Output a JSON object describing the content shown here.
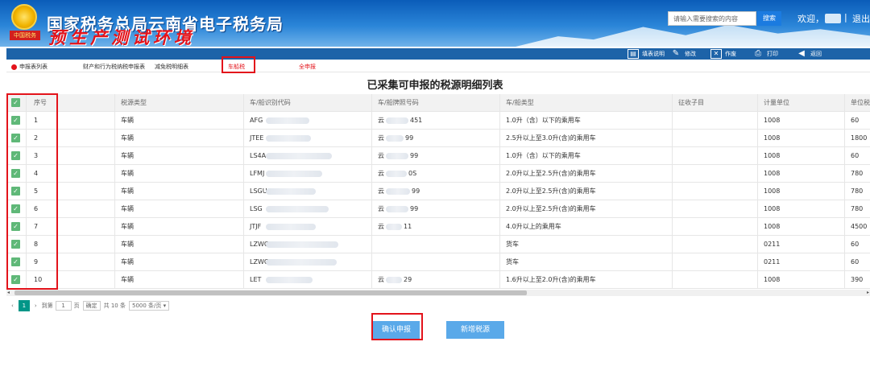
{
  "header": {
    "title": "国家税务总局云南省电子税务局",
    "subtitle": "预生产测试环境",
    "emblem_text": "中国税务",
    "search": {
      "placeholder": "请输入需要搜索的内容",
      "button": "搜索"
    },
    "welcome": "欢迎，",
    "separator": "|",
    "logout": "退出"
  },
  "toolbar": [
    {
      "label": "填表说明",
      "icon": "doc-icon"
    },
    {
      "label": "修改",
      "icon": "pencil-icon"
    },
    {
      "label": "作废",
      "icon": "void-icon"
    },
    {
      "label": "打印",
      "icon": "printer-icon"
    },
    {
      "label": "返回",
      "icon": "back-arrow-icon"
    }
  ],
  "tabs": [
    {
      "label": "申报表列表"
    },
    {
      "label": "财产和行为税纳税申报表"
    },
    {
      "label": "减免税明细表"
    },
    {
      "label": "车船税"
    },
    {
      "label": "全申报"
    }
  ],
  "page_title": "已采集可申报的税源明细列表",
  "table": {
    "columns": [
      "序号",
      "税源类型",
      "车/船识别代码",
      "车/船牌照号码",
      "车/船类型",
      "征收子目",
      "计量单位",
      "单位税"
    ],
    "rows": [
      {
        "no": "1",
        "type": "车辆",
        "code": "AFG",
        "plate_prefix": "云",
        "plate_suffix": "451",
        "vtype": "1.0升（含）以下的乘用车",
        "sub": "",
        "unit": "1008",
        "tax": "60"
      },
      {
        "no": "2",
        "type": "车辆",
        "code": "JTEE",
        "plate_prefix": "云",
        "plate_suffix": "99",
        "vtype": "2.5升以上至3.0升(含)的乘用车",
        "sub": "",
        "unit": "1008",
        "tax": "1800"
      },
      {
        "no": "3",
        "type": "车辆",
        "code": "LS4A",
        "plate_prefix": "云",
        "plate_suffix": "99",
        "vtype": "1.0升（含）以下的乘用车",
        "sub": "",
        "unit": "1008",
        "tax": "60"
      },
      {
        "no": "4",
        "type": "车辆",
        "code": "LFMJ",
        "plate_prefix": "云",
        "plate_suffix": "0S",
        "vtype": "2.0升以上至2.5升(含)的乘用车",
        "sub": "",
        "unit": "1008",
        "tax": "780"
      },
      {
        "no": "5",
        "type": "车辆",
        "code": "LSGU",
        "plate_prefix": "云",
        "plate_suffix": "99",
        "vtype": "2.0升以上至2.5升(含)的乘用车",
        "sub": "",
        "unit": "1008",
        "tax": "780"
      },
      {
        "no": "6",
        "type": "车辆",
        "code": "LSG",
        "plate_prefix": "云",
        "plate_suffix": "99",
        "vtype": "2.0升以上至2.5升(含)的乘用车",
        "sub": "",
        "unit": "1008",
        "tax": "780"
      },
      {
        "no": "7",
        "type": "车辆",
        "code": "JTJF",
        "plate_prefix": "云",
        "plate_suffix": "11",
        "vtype": "4.0升以上的乘用车",
        "sub": "",
        "unit": "1008",
        "tax": "4500"
      },
      {
        "no": "8",
        "type": "车辆",
        "code": "LZWC",
        "plate_prefix": "",
        "plate_suffix": "",
        "vtype": "货车",
        "sub": "",
        "unit": "0211",
        "tax": "60"
      },
      {
        "no": "9",
        "type": "车辆",
        "code": "LZWC",
        "plate_prefix": "",
        "plate_suffix": "",
        "vtype": "货车",
        "sub": "",
        "unit": "0211",
        "tax": "60"
      },
      {
        "no": "10",
        "type": "车辆",
        "code": "LET",
        "plate_prefix": "云",
        "plate_suffix": "29",
        "vtype": "1.6升以上至2.0升(含)的乘用车",
        "sub": "",
        "unit": "1008",
        "tax": "390"
      }
    ]
  },
  "pagination": {
    "current": "1",
    "goto_label": "到第",
    "page_input": "1",
    "page_unit": "页",
    "confirm": "确定",
    "total": "共 10 条",
    "page_size": "5000 条/页"
  },
  "actions": {
    "confirm": "确认申报",
    "add": "新增税源"
  },
  "colors": {
    "accent": "#1d63a8",
    "check": "#5fb878",
    "highlight": "#e3131b",
    "button": "#5aa9e9"
  }
}
